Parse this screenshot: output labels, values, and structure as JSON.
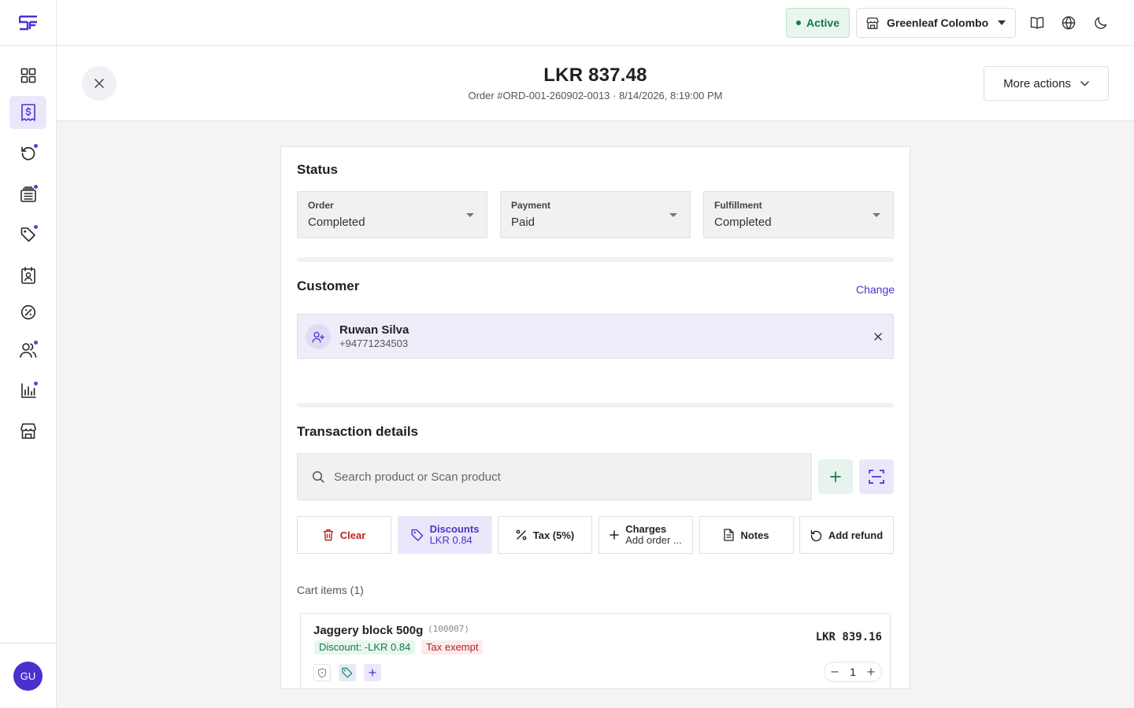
{
  "topbar": {
    "status": "Active",
    "store_name": "Greenleaf Colombo"
  },
  "header": {
    "amount": "LKR 837.48",
    "order_meta": "Order #ORD-001-260902-0013 · 8/14/2026, 8:19:00 PM",
    "more_actions": "More actions"
  },
  "sidebar": {
    "user_initials": "GU",
    "items": [
      {
        "icon": "dashboard-grid-icon",
        "active": false,
        "dot": false
      },
      {
        "icon": "receipt-dollar-icon",
        "active": true,
        "dot": false
      },
      {
        "icon": "refresh-history-icon",
        "active": false,
        "dot": true
      },
      {
        "icon": "inventory-stack-icon",
        "active": false,
        "dot": true
      },
      {
        "icon": "tag-icon",
        "active": false,
        "dot": true
      },
      {
        "icon": "contact-badge-icon",
        "active": false,
        "dot": false
      },
      {
        "icon": "discount-percent-icon",
        "active": false,
        "dot": false
      },
      {
        "icon": "users-icon",
        "active": false,
        "dot": true
      },
      {
        "icon": "bar-chart-icon",
        "active": false,
        "dot": true
      },
      {
        "icon": "store-icon",
        "active": false,
        "dot": false
      }
    ]
  },
  "status_section": {
    "title": "Status",
    "fields": [
      {
        "label": "Order",
        "value": "Completed"
      },
      {
        "label": "Payment",
        "value": "Paid"
      },
      {
        "label": "Fulfillment",
        "value": "Completed"
      }
    ]
  },
  "customer": {
    "title": "Customer",
    "change_label": "Change",
    "name": "Ruwan Silva",
    "phone": "+94771234503"
  },
  "transaction": {
    "title": "Transaction details",
    "search_placeholder": "Search product or Scan product",
    "actions": {
      "clear": "Clear",
      "discounts": "Discounts",
      "discounts_value": "LKR 0.84",
      "tax": "Tax (5%)",
      "charges": "Charges",
      "charges_sub": "Add order ...",
      "notes": "Notes",
      "add_refund": "Add refund"
    },
    "cart_label": "Cart items (1)",
    "cart_items": [
      {
        "name": "Jaggery block 500g",
        "sku": "(100007)",
        "price": "LKR 839.16",
        "discount_tag": "Discount: -LKR 0.84",
        "tax_tag": "Tax exempt",
        "quantity": "1"
      }
    ]
  },
  "colors": {
    "accent": "#4a33c9",
    "success": "#16794a",
    "danger": "#c02424"
  }
}
